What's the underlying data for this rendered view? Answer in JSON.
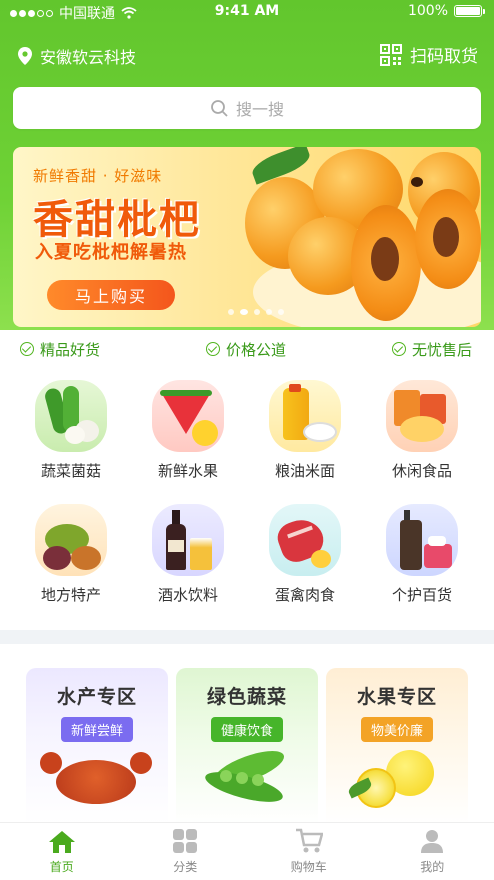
{
  "status_bar": {
    "carrier": "中国联通",
    "time": "9:41 AM",
    "battery": "100%"
  },
  "header": {
    "location": "安徽软云科技",
    "scan_label": "扫码取货"
  },
  "search": {
    "placeholder": "搜一搜"
  },
  "banner": {
    "subtitle": "新鲜香甜 · 好滋味",
    "title": "香甜枇杷",
    "slogan": "入夏吃枇杷解暑热",
    "button": "马上购买",
    "slide_count": 5,
    "active_slide": 2
  },
  "guarantees": [
    "精品好货",
    "价格公道",
    "无忧售后"
  ],
  "categories": [
    {
      "label": "蔬菜菌菇",
      "icon": "vegetable-icon"
    },
    {
      "label": "新鲜水果",
      "icon": "watermelon-icon"
    },
    {
      "label": "粮油米面",
      "icon": "oil-rice-icon"
    },
    {
      "label": "休闲食品",
      "icon": "snack-icon"
    },
    {
      "label": "地方特产",
      "icon": "specialty-icon"
    },
    {
      "label": "酒水饮料",
      "icon": "wine-icon"
    },
    {
      "label": "蛋禽肉食",
      "icon": "meat-icon"
    },
    {
      "label": "个护百货",
      "icon": "care-icon"
    }
  ],
  "zones": [
    {
      "title": "水产专区",
      "badge": "新鲜尝鲜",
      "color": "#7b6cf0",
      "icon": "crab-icon"
    },
    {
      "title": "绿色蔬菜",
      "badge": "健康饮食",
      "color": "#46b52a",
      "icon": "peas-icon"
    },
    {
      "title": "水果专区",
      "badge": "物美价廉",
      "color": "#f3a326",
      "icon": "lemon-icon"
    }
  ],
  "tabbar": [
    {
      "label": "首页",
      "icon": "home-icon",
      "active": true
    },
    {
      "label": "分类",
      "icon": "category-icon",
      "active": false
    },
    {
      "label": "购物车",
      "icon": "cart-icon",
      "active": false
    },
    {
      "label": "我的",
      "icon": "user-icon",
      "active": false
    }
  ]
}
